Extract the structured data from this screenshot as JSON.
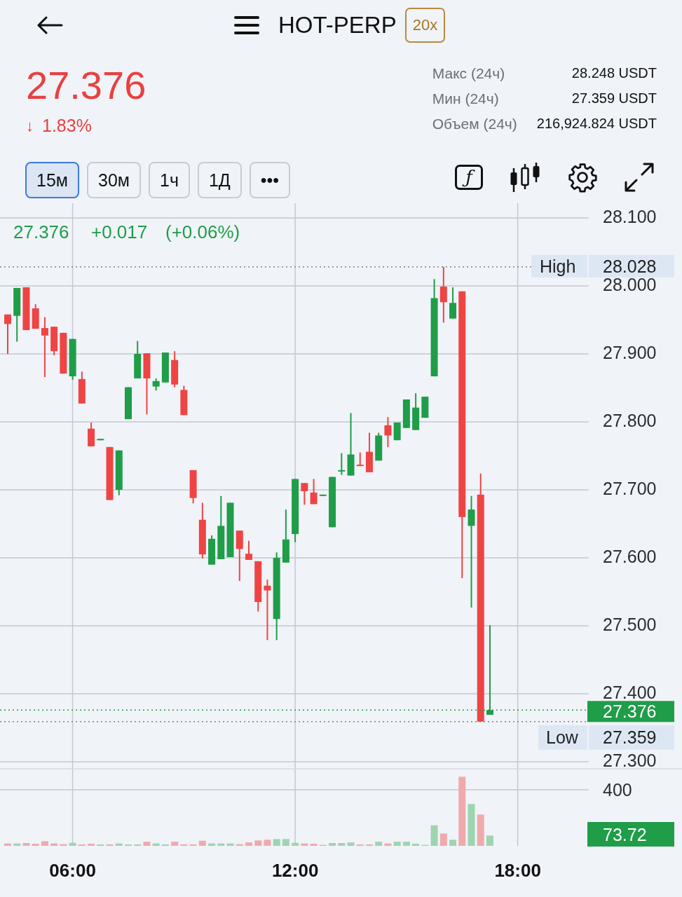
{
  "header": {
    "symbol": "HOT-PERP",
    "leverage": "20x"
  },
  "summary": {
    "price": "27.376",
    "arrow": "↓",
    "change": "1.83%",
    "stats": [
      {
        "label": "Макс (24ч)",
        "value": "28.248 USDT"
      },
      {
        "label": "Мин (24ч)",
        "value": "27.359 USDT"
      },
      {
        "label": "Объем (24ч)",
        "value": "216,924.824 USDT"
      }
    ]
  },
  "intervals": [
    {
      "label": "15м",
      "selected": true
    },
    {
      "label": "30м",
      "selected": false
    },
    {
      "label": "1ч",
      "selected": false
    },
    {
      "label": "1Д",
      "selected": false
    },
    {
      "label": "•••",
      "selected": false
    }
  ],
  "toolbar": {
    "function_label": "ƒ"
  },
  "chart": {
    "legend": {
      "price": "27.376",
      "change": "+0.017",
      "change_pct": "(+0.06%)"
    },
    "price_tags": [
      {
        "kind": "high",
        "label": "High",
        "value": "28.028"
      },
      {
        "kind": "last",
        "value": "27.376"
      },
      {
        "kind": "low",
        "label": "Low",
        "value": "27.359"
      }
    ],
    "chart_data": {
      "type": "candlestick",
      "grid": true,
      "ylim": [
        27.3,
        28.1
      ],
      "yticks": [
        {
          "value": 28.1,
          "label": "28.100"
        },
        {
          "value": 28.0,
          "label": "28.000"
        },
        {
          "value": 27.9,
          "label": "27.900"
        },
        {
          "value": 27.8,
          "label": "27.800"
        },
        {
          "value": 27.7,
          "label": "27.700"
        },
        {
          "value": 27.6,
          "label": "27.600"
        },
        {
          "value": 27.5,
          "label": "27.500"
        },
        {
          "value": 27.4,
          "label": "27.400"
        },
        {
          "value": 27.3,
          "label": "27.300"
        }
      ],
      "categories": [
        null,
        null,
        null,
        null,
        null,
        null,
        null,
        "06:00",
        null,
        null,
        null,
        null,
        null,
        null,
        null,
        null,
        null,
        null,
        null,
        null,
        null,
        null,
        null,
        null,
        null,
        null,
        null,
        null,
        null,
        null,
        null,
        "12:00",
        null,
        null,
        null,
        null,
        null,
        null,
        null,
        null,
        null,
        null,
        null,
        null,
        null,
        null,
        null,
        null,
        null,
        null,
        null,
        null,
        null,
        null,
        null,
        "18:00"
      ],
      "ohlc": [
        [
          27.958,
          27.958,
          27.9,
          27.944
        ],
        [
          27.956,
          27.997,
          27.918,
          27.997
        ],
        [
          27.998,
          27.998,
          27.935,
          27.935
        ],
        [
          27.967,
          27.973,
          27.937,
          27.937
        ],
        [
          27.938,
          27.954,
          27.866,
          27.927
        ],
        [
          27.94,
          27.94,
          27.898,
          27.904
        ],
        [
          27.931,
          27.931,
          27.871,
          27.871
        ],
        [
          27.867,
          27.922,
          27.862,
          27.922
        ],
        [
          27.863,
          27.874,
          27.827,
          27.827
        ],
        [
          27.79,
          27.799,
          27.764,
          27.764
        ],
        [
          27.773,
          27.775,
          27.773,
          27.775
        ],
        [
          27.763,
          27.763,
          27.685,
          27.685
        ],
        [
          27.7,
          27.758,
          27.692,
          27.758
        ],
        [
          27.804,
          27.851,
          27.804,
          27.851
        ],
        [
          27.864,
          27.919,
          27.864,
          27.9
        ],
        [
          27.901,
          27.901,
          27.811,
          27.864
        ],
        [
          27.852,
          27.864,
          27.846,
          27.86
        ],
        [
          27.858,
          27.902,
          27.858,
          27.902
        ],
        [
          27.891,
          27.904,
          27.851,
          27.855
        ],
        [
          27.847,
          27.853,
          27.81,
          27.81
        ],
        [
          27.729,
          27.729,
          27.68,
          27.688
        ],
        [
          27.656,
          27.681,
          27.599,
          27.605
        ],
        [
          27.59,
          27.633,
          27.59,
          27.628
        ],
        [
          27.598,
          27.691,
          27.598,
          27.647
        ],
        [
          27.601,
          27.681,
          27.601,
          27.681
        ],
        [
          27.64,
          27.64,
          27.566,
          27.613
        ],
        [
          27.606,
          27.625,
          27.597,
          27.597
        ],
        [
          27.595,
          27.595,
          27.521,
          27.535
        ],
        [
          27.559,
          27.568,
          27.479,
          27.552
        ],
        [
          27.51,
          27.608,
          27.479,
          27.6
        ],
        [
          27.593,
          27.671,
          27.593,
          27.627
        ],
        [
          27.635,
          27.716,
          27.623,
          27.716
        ],
        [
          27.71,
          27.71,
          27.678,
          27.698
        ],
        [
          27.696,
          27.716,
          27.679,
          27.679
        ],
        [
          27.691,
          27.693,
          27.691,
          27.693
        ],
        [
          27.645,
          27.719,
          27.645,
          27.719
        ],
        [
          27.727,
          27.754,
          27.722,
          27.729
        ],
        [
          27.721,
          27.813,
          27.721,
          27.752
        ],
        [
          27.737,
          27.755,
          27.735,
          27.735
        ],
        [
          27.756,
          27.784,
          27.726,
          27.726
        ],
        [
          27.743,
          27.784,
          27.743,
          27.78
        ],
        [
          27.795,
          27.807,
          27.763,
          27.78
        ],
        [
          27.773,
          27.799,
          27.773,
          27.799
        ],
        [
          27.791,
          27.833,
          27.791,
          27.833
        ],
        [
          27.788,
          27.842,
          27.788,
          27.821
        ],
        [
          27.806,
          27.837,
          27.806,
          27.837
        ],
        [
          27.867,
          28.01,
          27.867,
          27.982
        ],
        [
          27.999,
          28.028,
          27.946,
          27.976
        ],
        [
          27.952,
          27.998,
          27.952,
          27.975
        ],
        [
          27.992,
          27.992,
          27.57,
          27.66
        ],
        [
          27.647,
          27.691,
          27.527,
          27.671
        ],
        [
          27.693,
          27.724,
          27.359,
          27.359
        ],
        [
          27.369,
          27.501,
          27.369,
          27.376
        ],
        null,
        null,
        null
      ]
    }
  },
  "volume": {
    "axis_label": "400",
    "last_value": "73.72"
  }
}
